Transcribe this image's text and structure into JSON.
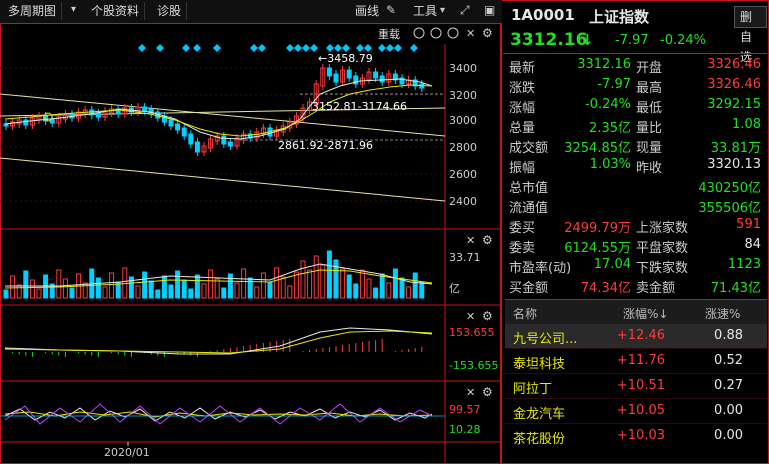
{
  "toolbar": {
    "period": "多周期图",
    "stock_info": "个股资料",
    "diagnose": "诊股",
    "draw_line": "画线",
    "tools": "工具"
  },
  "main_chart": {
    "reload": "重载",
    "high_label": "←3458.79",
    "range1": "3152.81-3174.66",
    "range2": "2861.92-2871.96",
    "y_ticks": [
      "3400",
      "3200",
      "3000",
      "2800",
      "2600",
      "2400"
    ]
  },
  "volume_pane": {
    "max": "33.71",
    "unit": "亿"
  },
  "macd_pane": {
    "top": "153.655",
    "bottom": "-153.655"
  },
  "kdj_pane": {
    "top": "99.57",
    "bottom": "10.28"
  },
  "x_axis": {
    "date_label": "2020/01"
  },
  "quote": {
    "code": "1A0001",
    "name": "上证指数",
    "remove_btn": "删自选",
    "price": "3312.16",
    "change": "-7.97",
    "change_pct": "-0.24%",
    "rows": [
      {
        "l1": "最新",
        "v1": "3312.16",
        "c1": "green",
        "l2": "开盘",
        "v2": "3326.46",
        "c2": "red"
      },
      {
        "l1": "涨跌",
        "v1": "-7.97",
        "c1": "green",
        "l2": "最高",
        "v2": "3326.46",
        "c2": "red"
      },
      {
        "l1": "涨幅",
        "v1": "-0.24%",
        "c1": "green",
        "l2": "最低",
        "v2": "3292.15",
        "c2": "green"
      },
      {
        "l1": "总量",
        "v1": "2.35亿",
        "c1": "green",
        "l2": "量比",
        "v2": "1.08",
        "c2": "green"
      },
      {
        "l1": "成交额",
        "v1": "3254.85亿",
        "c1": "green",
        "l2": "现量",
        "v2": "33.81万",
        "c2": "green"
      },
      {
        "l1": "振幅",
        "v1": "1.03%",
        "c1": "green",
        "l2": "昨收",
        "v2": "3320.13",
        "c2": "white"
      }
    ],
    "rows2": [
      {
        "l1": "总市值",
        "v1": "430250亿",
        "c1": "green"
      },
      {
        "l1": "流通值",
        "v1": "355506亿",
        "c1": "green"
      }
    ],
    "rows3": [
      {
        "l1": "委买",
        "v1": "2499.79万",
        "c1": "red",
        "l2": "上涨家数",
        "v2": "591",
        "c2": "red"
      },
      {
        "l1": "委卖",
        "v1": "6124.55万",
        "c1": "green",
        "l2": "平盘家数",
        "v2": "84",
        "c2": "white"
      },
      {
        "l1": "市盈率(动)",
        "v1": "17.04",
        "c1": "green",
        "l2": "下跌家数",
        "v2": "1123",
        "c2": "green"
      },
      {
        "l1": "买金额",
        "v1": "74.34亿",
        "c1": "red",
        "l2": "卖金额",
        "v2": "71.43亿",
        "c2": "green"
      }
    ]
  },
  "ranking": {
    "headers": [
      "名称",
      "涨幅%↓",
      "涨速%"
    ],
    "rows": [
      {
        "name": "九号公司...",
        "pct": "+12.46",
        "speed": "0.88"
      },
      {
        "name": "泰坦科技",
        "pct": "+11.76",
        "speed": "0.52"
      },
      {
        "name": "阿拉丁",
        "pct": "+10.51",
        "speed": "0.27"
      },
      {
        "name": "金龙汽车",
        "pct": "+10.05",
        "speed": "0.00"
      },
      {
        "name": "茶花股份",
        "pct": "+10.03",
        "speed": "0.00"
      }
    ]
  }
}
